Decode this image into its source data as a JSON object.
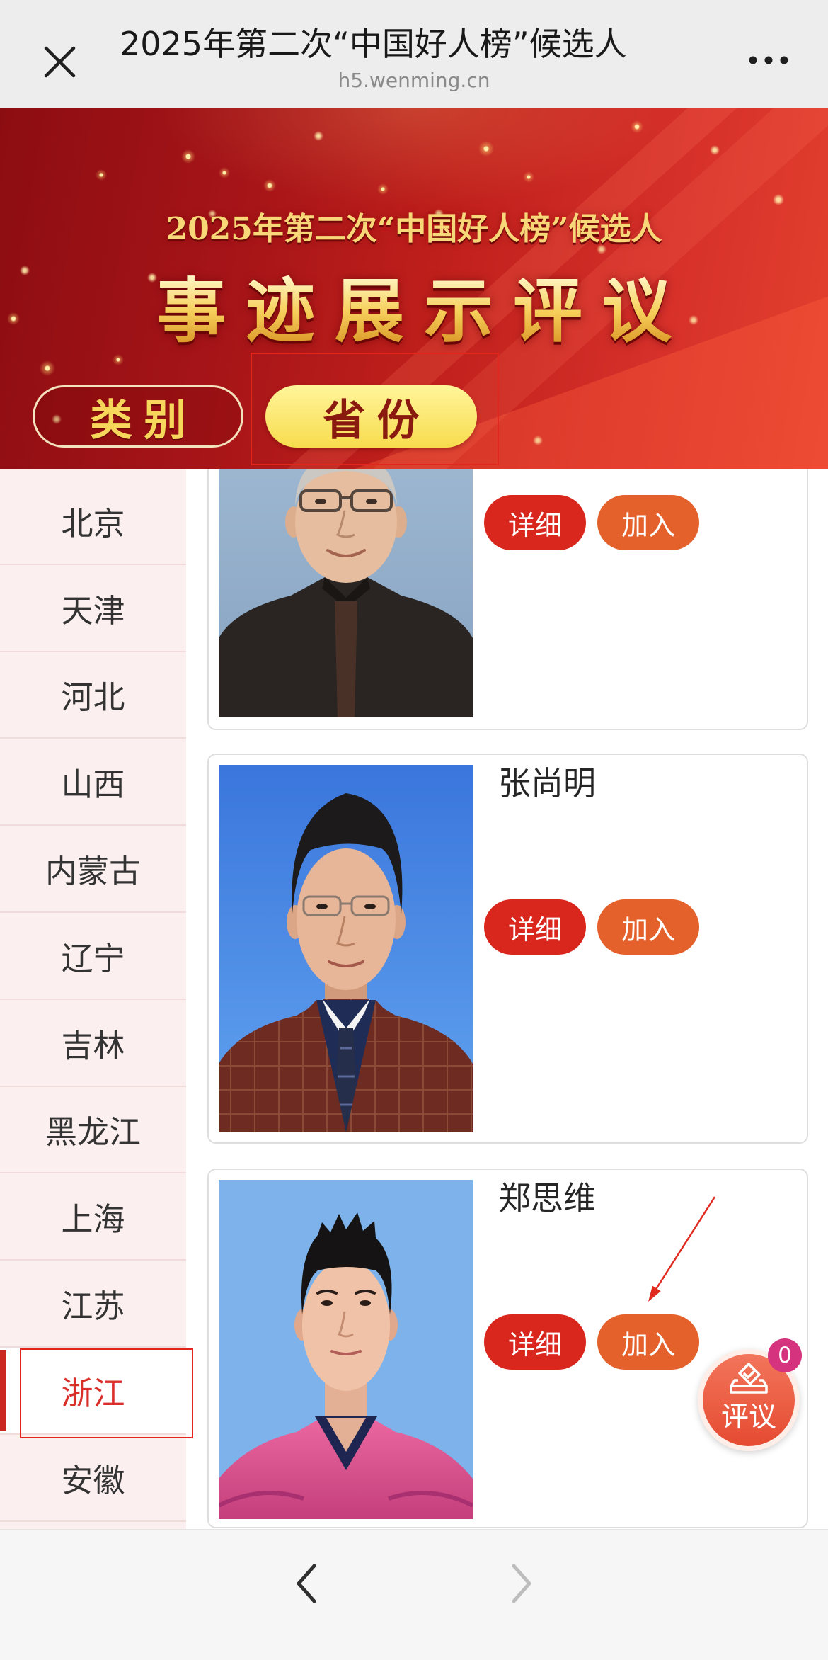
{
  "topbar": {
    "title": "2025年第二次“中国好人榜”候选人",
    "domain": "h5.wenming.cn",
    "close_icon": "close-icon",
    "more_icon": "more-icon"
  },
  "banner": {
    "subtitle": "2025年第二次“中国好人榜”候选人",
    "title": "事迹展示评议",
    "tabs": [
      {
        "label": "类别",
        "active": false
      },
      {
        "label": "省份",
        "active": true
      }
    ]
  },
  "sidebar": {
    "items": [
      {
        "label": "北京"
      },
      {
        "label": "天津"
      },
      {
        "label": "河北"
      },
      {
        "label": "山西"
      },
      {
        "label": "内蒙古"
      },
      {
        "label": "辽宁"
      },
      {
        "label": "吉林"
      },
      {
        "label": "黑龙江"
      },
      {
        "label": "上海"
      },
      {
        "label": "江苏"
      },
      {
        "label": "浙江",
        "active": true
      },
      {
        "label": "安徽"
      }
    ]
  },
  "candidates": [
    {
      "detail_label": "详细",
      "join_label": "加入"
    },
    {
      "name": "张尚明",
      "detail_label": "详细",
      "join_label": "加入"
    },
    {
      "name": "郑思维",
      "detail_label": "详细",
      "join_label": "加入"
    }
  ],
  "review_button": {
    "label": "评议",
    "count": 0,
    "icon": "ballot-box-icon"
  },
  "nav": {
    "back_icon": "chevron-left-icon",
    "forward_icon": "chevron-right-icon",
    "forward_enabled": false
  },
  "colors": {
    "primary_red": "#d9271e",
    "join_orange": "#e4612b",
    "active_text": "#d9302b",
    "badge": "#d6337e",
    "gold": "#f7d777",
    "sidebar_bg": "#fcefef"
  }
}
